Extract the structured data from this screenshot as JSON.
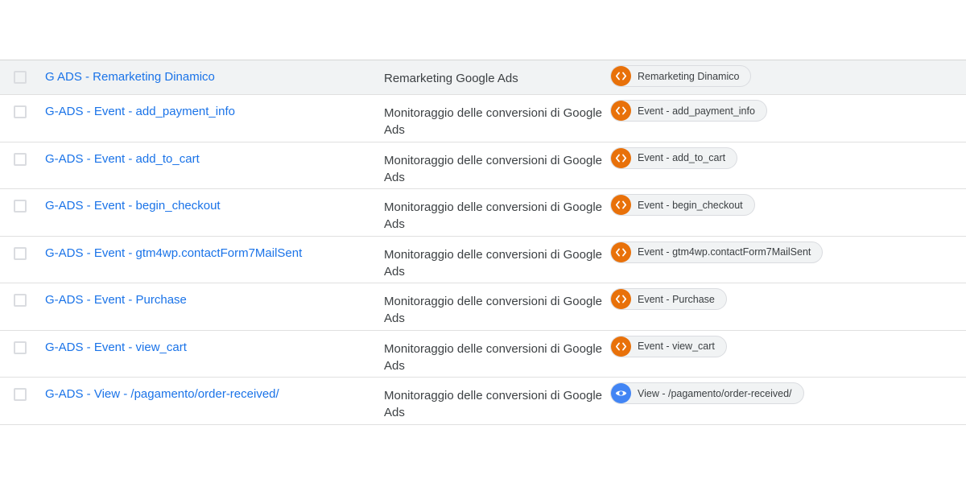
{
  "tags": [
    {
      "name": "G ADS - Remarketing Dinamico",
      "type": "Remarketing Google Ads",
      "trigger": {
        "icon": "code-icon",
        "color": "#e8710a",
        "label": "Remarketing Dinamico"
      },
      "highlighted": true
    },
    {
      "name": "G-ADS - Event - add_payment_info",
      "type": "Monitoraggio delle conversioni di Google Ads",
      "trigger": {
        "icon": "code-icon",
        "color": "#e8710a",
        "label": "Event - add_payment_info"
      }
    },
    {
      "name": "G-ADS - Event - add_to_cart",
      "type": "Monitoraggio delle conversioni di Google Ads",
      "trigger": {
        "icon": "code-icon",
        "color": "#e8710a",
        "label": "Event - add_to_cart"
      }
    },
    {
      "name": "G-ADS - Event - begin_checkout",
      "type": "Monitoraggio delle conversioni di Google Ads",
      "trigger": {
        "icon": "code-icon",
        "color": "#e8710a",
        "label": "Event - begin_checkout"
      }
    },
    {
      "name": "G-ADS - Event - gtm4wp.contactForm7MailSent",
      "type": "Monitoraggio delle conversioni di Google Ads",
      "trigger": {
        "icon": "code-icon",
        "color": "#e8710a",
        "label": "Event - gtm4wp.contactForm7MailSent"
      }
    },
    {
      "name": "G-ADS - Event - Purchase",
      "type": "Monitoraggio delle conversioni di Google Ads",
      "trigger": {
        "icon": "code-icon",
        "color": "#e8710a",
        "label": "Event - Purchase"
      }
    },
    {
      "name": "G-ADS - Event - view_cart",
      "type": "Monitoraggio delle conversioni di Google Ads",
      "trigger": {
        "icon": "code-icon",
        "color": "#e8710a",
        "label": "Event - view_cart"
      }
    },
    {
      "name": "G-ADS - View - /pagamento/order-received/",
      "type": "Monitoraggio delle conversioni di Google Ads",
      "trigger": {
        "icon": "eye-icon",
        "color": "#4285f4",
        "label": "View - /pagamento/order-received/"
      }
    }
  ]
}
